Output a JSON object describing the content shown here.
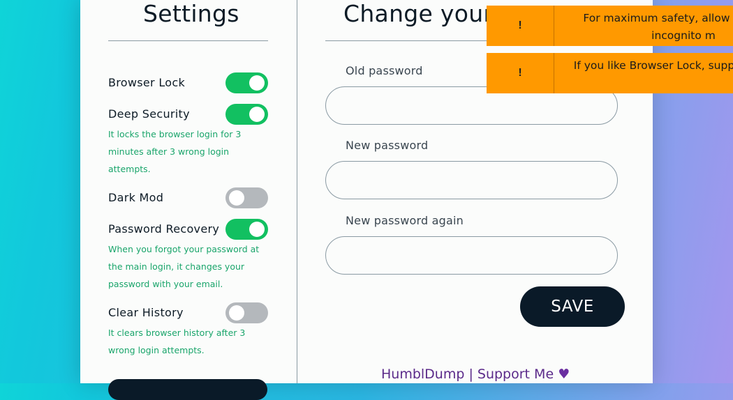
{
  "settings": {
    "title": "Settings",
    "items": [
      {
        "label": "Browser Lock",
        "enabled": true,
        "description": ""
      },
      {
        "label": "Deep Security",
        "enabled": true,
        "description": "It locks the browser login for 3 minutes after 3 wrong login attempts."
      },
      {
        "label": "Dark Mod",
        "enabled": false,
        "description": ""
      },
      {
        "label": "Password Recovery",
        "enabled": true,
        "description": "When you forgot your password at the main login, it changes your password with your email."
      },
      {
        "label": "Clear History",
        "enabled": false,
        "description": "It clears browser history after 3 wrong login attempts."
      }
    ]
  },
  "password": {
    "title": "Change your",
    "old_label": "Old password",
    "new_label": "New password",
    "again_label": "New password again",
    "old_value": "",
    "new_value": "",
    "again_value": "",
    "save_label": "SAVE"
  },
  "footer": {
    "text": "HumblDump | Support Me",
    "heart": "♥"
  },
  "toasts": [
    {
      "icon": "!",
      "text": "For maximum safety, allow B work in incognito m"
    },
    {
      "icon": "!",
      "text": "If you like Browser Lock, supp patreon ♥"
    }
  ],
  "colors": {
    "toggle_on": "#12c061",
    "toggle_off": "#b4b8bc",
    "description": "#1aa56b",
    "toast": "#ff9900",
    "button": "#0a1a28"
  }
}
